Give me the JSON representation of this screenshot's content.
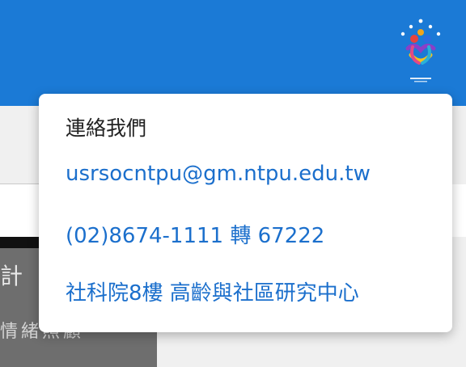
{
  "colors": {
    "header_bg": "#1b7ad6",
    "link": "#1b6fcc",
    "popup_bg": "#ffffff"
  },
  "header": {
    "logo_icon": "organization-logo-icon"
  },
  "background": {
    "image_text_line1": "計",
    "image_text_line2": "情緒照顧"
  },
  "contact_popup": {
    "title": "連絡我們",
    "email": "usrsocntpu@gm.ntpu.edu.tw",
    "phone": "(02)8674-1111 轉 67222",
    "address": "社科院8樓 高齡與社區研究中心"
  }
}
